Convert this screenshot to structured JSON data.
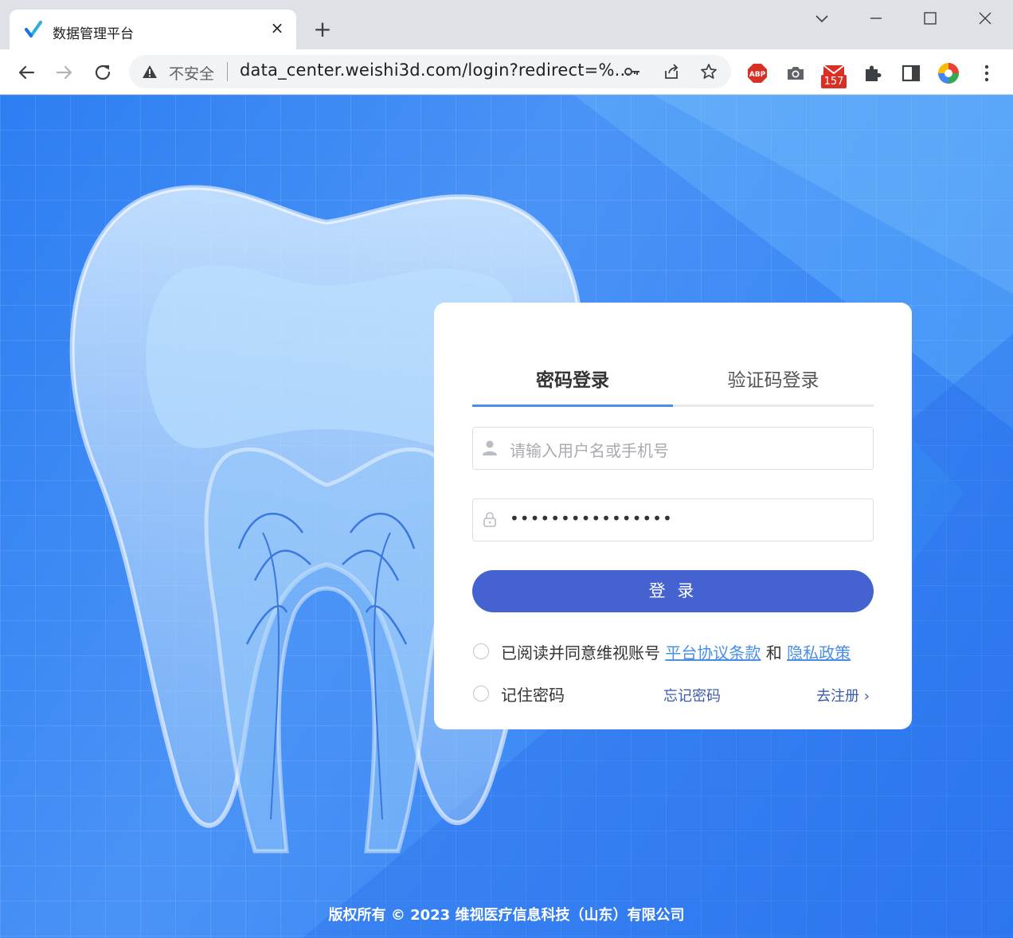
{
  "browser": {
    "tab_title": "数据管理平台",
    "tab_close": "×",
    "new_tab": "+",
    "security_label": "不安全",
    "url": "data_center.weishi3d.com/login?redirect=%...",
    "extension_badge": "157",
    "abp_label": "ABP"
  },
  "login": {
    "tabs": [
      {
        "label": "密码登录",
        "active": true
      },
      {
        "label": "验证码登录",
        "active": false
      }
    ],
    "username_placeholder": "请输入用户名或手机号",
    "password_value": "••••••••••••••••",
    "submit_label": "登 录",
    "agreement_prefix": "已阅读并同意维视账号",
    "terms_link": "平台协议条款",
    "and": "和",
    "privacy_link": "隐私政策",
    "remember_label": "记住密码",
    "forgot_label": "忘记密码",
    "register_label": "去注册",
    "register_chevron": "›"
  },
  "footer": {
    "copyright": "版权所有 © 2023 维视医疗信息科技（山东）有限公司"
  },
  "colors": {
    "primary_button": "#4463d1",
    "link": "#4a8ee8",
    "background": "#3a87f4"
  }
}
